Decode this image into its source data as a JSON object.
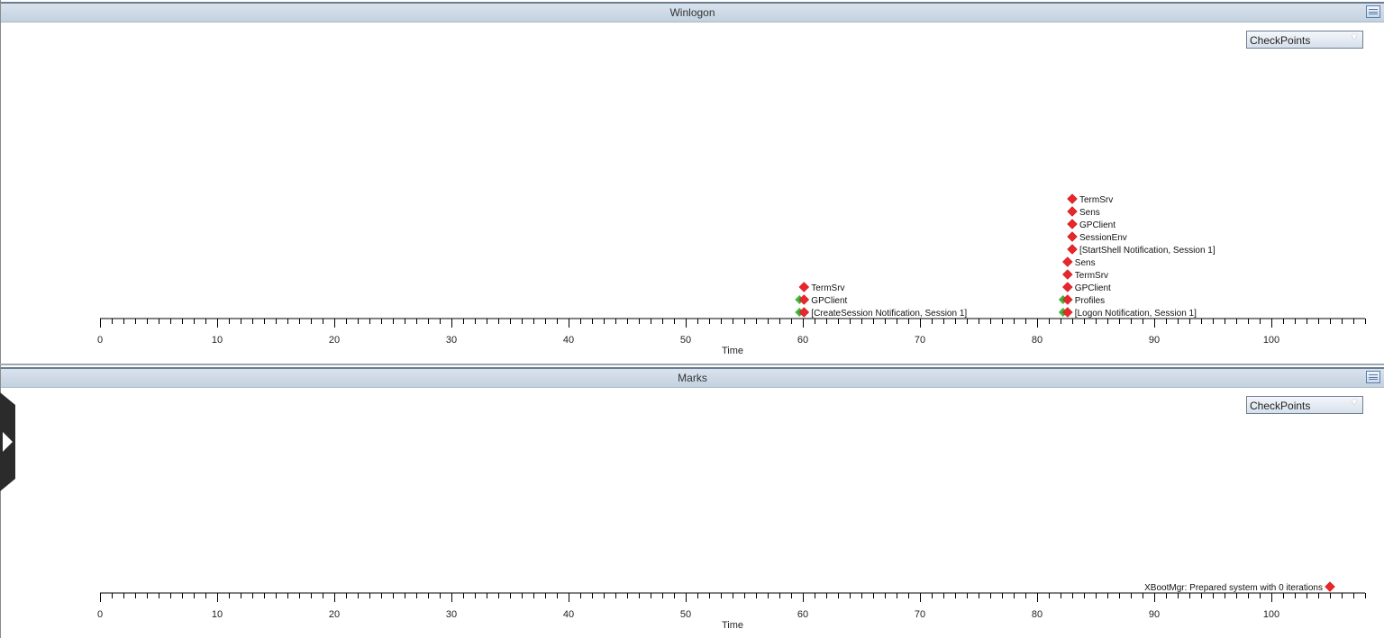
{
  "panels": [
    {
      "id": "winlogon",
      "title": "Winlogon",
      "dropdown_value": "CheckPoints",
      "x_label": "Time",
      "x_ticks": [
        0,
        10,
        20,
        30,
        40,
        50,
        60,
        70,
        80,
        90,
        100
      ],
      "x_range": [
        0,
        108
      ],
      "markers": [
        {
          "time": 60.1,
          "row": 0,
          "label": "[CreateSession Notification, Session 1]",
          "green": true
        },
        {
          "time": 60.1,
          "row": 1,
          "label": "GPClient",
          "green": true
        },
        {
          "time": 60.1,
          "row": 2,
          "label": "TermSrv",
          "green": false
        },
        {
          "time": 82.6,
          "row": 0,
          "label": "[Logon Notification, Session 1]",
          "green": true
        },
        {
          "time": 82.6,
          "row": 1,
          "label": "Profiles",
          "green": true
        },
        {
          "time": 82.6,
          "row": 2,
          "label": "GPClient",
          "green": false
        },
        {
          "time": 82.6,
          "row": 3,
          "label": "TermSrv",
          "green": false
        },
        {
          "time": 82.6,
          "row": 4,
          "label": "Sens",
          "green": false
        },
        {
          "time": 83.0,
          "row": 5,
          "label": "[StartShell Notification, Session 1]",
          "green": false
        },
        {
          "time": 83.0,
          "row": 6,
          "label": "SessionEnv",
          "green": false
        },
        {
          "time": 83.0,
          "row": 7,
          "label": "GPClient",
          "green": false
        },
        {
          "time": 83.0,
          "row": 8,
          "label": "Sens",
          "green": false
        },
        {
          "time": 83.0,
          "row": 9,
          "label": "TermSrv",
          "green": false
        }
      ]
    },
    {
      "id": "marks",
      "title": "Marks",
      "dropdown_value": "CheckPoints",
      "x_label": "Time",
      "x_ticks": [
        0,
        10,
        20,
        30,
        40,
        50,
        60,
        70,
        80,
        90,
        100
      ],
      "x_range": [
        0,
        108
      ],
      "markers": [
        {
          "time": 105,
          "row": 0,
          "label": "XBootMgr: Prepared system with 0 iterations",
          "green": false,
          "label_side": "left"
        }
      ]
    }
  ],
  "colors": {
    "marker_red": "#e8262b",
    "marker_green": "#3cb83a",
    "header_bg": "#c9d6e3"
  }
}
